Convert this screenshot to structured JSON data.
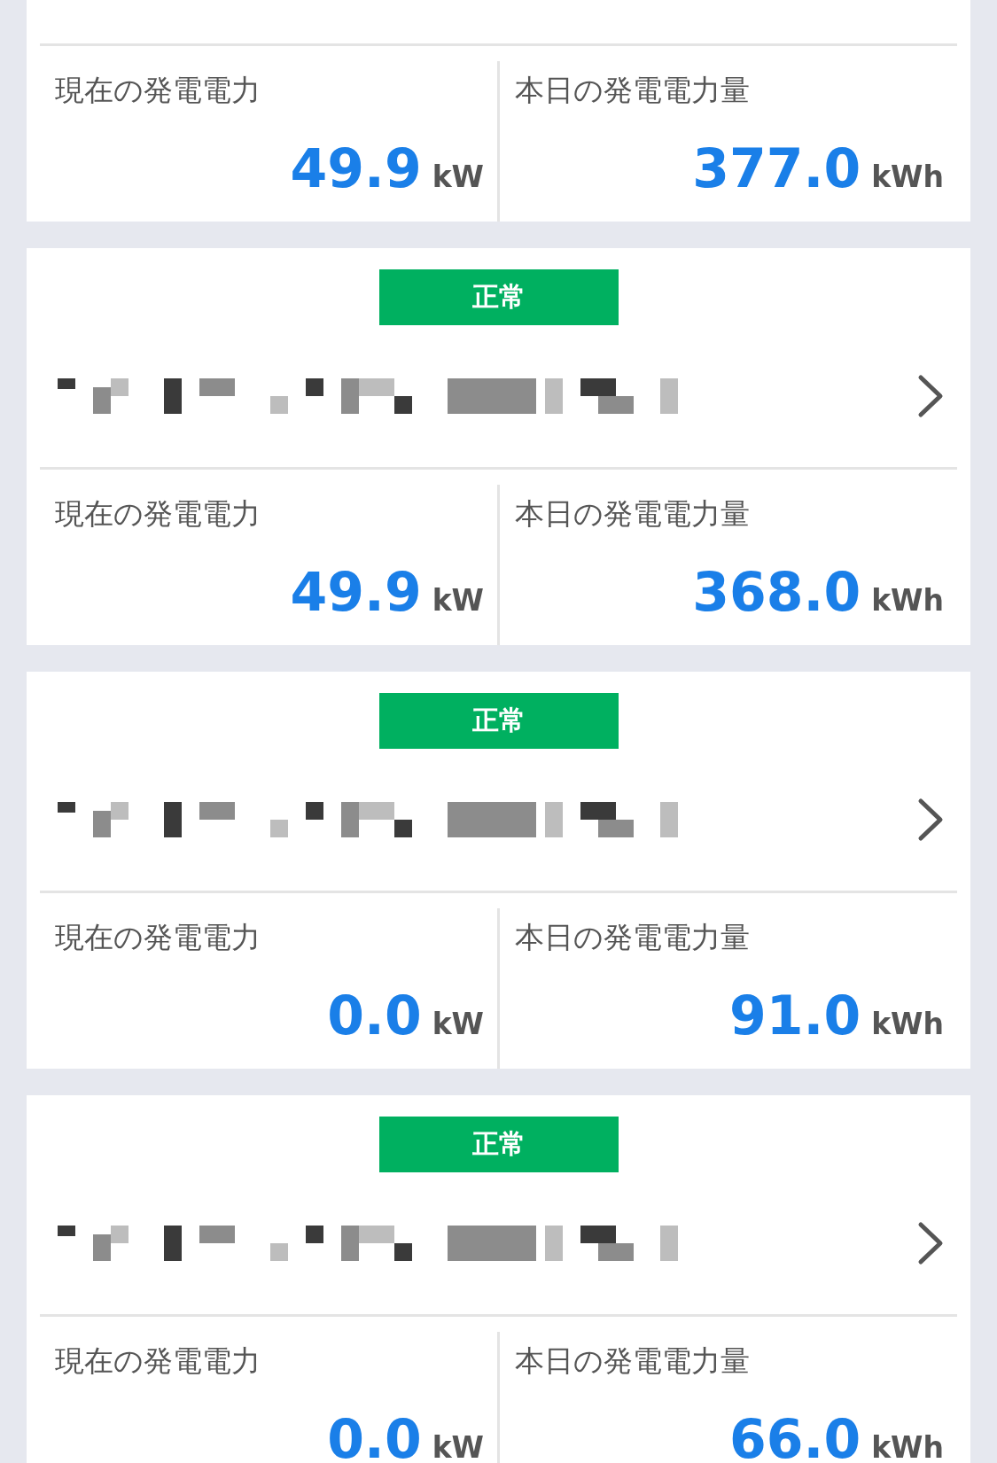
{
  "stations": [
    {
      "stats": [
        {
          "label": "現在の発電電力",
          "value": "49.9",
          "unit": "kW"
        },
        {
          "label": "本日の発電電力量",
          "value": "377.0",
          "unit": "kWh"
        }
      ]
    },
    {
      "status": "正常",
      "stats": [
        {
          "label": "現在の発電電力",
          "value": "49.9",
          "unit": "kW"
        },
        {
          "label": "本日の発電電力量",
          "value": "368.0",
          "unit": "kWh"
        }
      ]
    },
    {
      "status": "正常",
      "stats": [
        {
          "label": "現在の発電電力",
          "value": "0.0",
          "unit": "kW"
        },
        {
          "label": "本日の発電電力量",
          "value": "91.0",
          "unit": "kWh"
        }
      ]
    },
    {
      "status": "正常",
      "stats": [
        {
          "label": "現在の発電電力",
          "value": "0.0",
          "unit": "kW"
        },
        {
          "label": "本日の発電電力量",
          "value": "66.0",
          "unit": "kWh"
        }
      ]
    }
  ]
}
